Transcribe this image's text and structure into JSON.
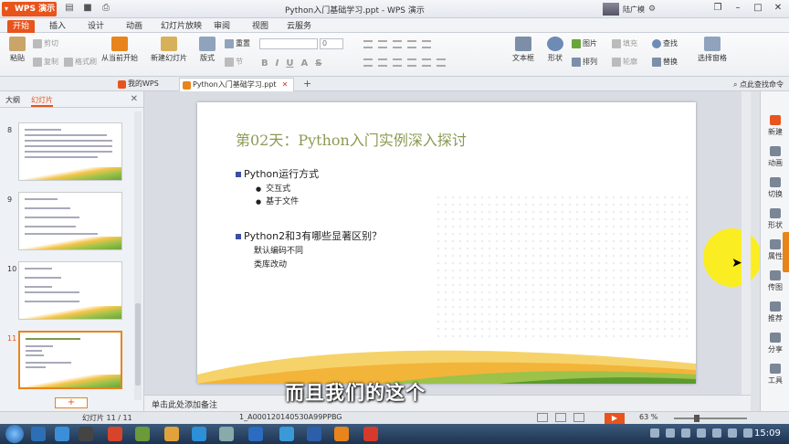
{
  "app": {
    "logo_label": "WPS 演示",
    "window_title": "Python入门基础学习.ppt - WPS 演示",
    "user_name": "陆广模"
  },
  "menu_tabs": [
    "开始",
    "插入",
    "设计",
    "动画",
    "幻灯片放映",
    "审阅",
    "视图",
    "云服务"
  ],
  "ribbon": {
    "paste": "粘贴",
    "cut": "剪切",
    "copy": "复制",
    "format_painter": "格式刷",
    "from_current": "从当前开始",
    "new_slide": "新建幻灯片",
    "layout": "版式",
    "reset": "重置",
    "section": "节",
    "font_size": "0",
    "textbox": "文本框",
    "shape": "形状",
    "picture": "图片",
    "arrange": "排列",
    "fill": "填充",
    "outline": "轮廓",
    "find": "查找",
    "replace": "替换",
    "select_pane": "选择窗格"
  },
  "tabstrip": {
    "tab1": "我的WPS",
    "tab2": "Python入门基础学习.ppt",
    "search_help": "点此查找命令"
  },
  "left_panel": {
    "tab_outline": "大纲",
    "tab_slides": "幻灯片",
    "thumb_numbers": [
      "8",
      "9",
      "10",
      "11"
    ]
  },
  "slide": {
    "title": "第02天：Python入门实例深入探讨",
    "bullet1": "Python运行方式",
    "sub1": "交互式",
    "sub2": "基于文件",
    "bullet2": "Python2和3有哪些显著区别？",
    "plain1": "默认编码不同",
    "plain2": "类库改动"
  },
  "right_bar": [
    "新建",
    "动画",
    "切换",
    "形状",
    "属性",
    "传图",
    "推荐",
    "分享",
    "工具"
  ],
  "notes": {
    "placeholder": "单击此处添加备注"
  },
  "caption": "而且我们的这个",
  "status": {
    "slide_count": "幻灯片 11 / 11",
    "template": "1_A000120140530A99PPBG",
    "zoom": "63 %"
  },
  "taskbar": {
    "clock": "15:09"
  }
}
